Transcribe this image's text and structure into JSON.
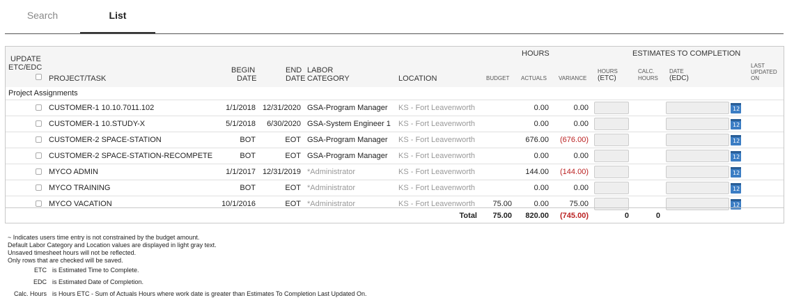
{
  "tabs": [
    {
      "label": "Search"
    },
    {
      "label": "List"
    }
  ],
  "headers": {
    "update": "UPDATE",
    "etc_edc": "ETC/EDC",
    "project_task": "PROJECT/TASK",
    "begin": "BEGIN",
    "begin2": "DATE",
    "end": "END",
    "end2": "DATE",
    "labor": "LABOR",
    "labor2": "CATEGORY",
    "location": "LOCATION",
    "hours": "HOURS",
    "budget": "BUDGET",
    "actuals": "ACTUALS",
    "variance": "VARIANCE",
    "etc_group": "ESTIMATES TO COMPLETION",
    "hours_etc_a": "HOURS",
    "hours_etc_b": "(ETC)",
    "calc_a": "CALC.",
    "calc_b": "HOURS",
    "date_edc_a": "DATE",
    "date_edc_b": "(EDC)",
    "last_a": "LAST",
    "last_b": "UPDATED",
    "last_c": "ON"
  },
  "section_label": "Project Assignments",
  "rows": [
    {
      "project": "CUSTOMER-1 10.10.7011.102",
      "begin": "1/1/2018",
      "end": "12/31/2020",
      "labor": "GSA-Program Manager",
      "location": "KS - Fort Leavenworth",
      "budget": "",
      "actuals": "0.00",
      "variance": "0.00"
    },
    {
      "project": "CUSTOMER-1 10.STUDY-X",
      "begin": "5/1/2018",
      "end": "6/30/2020",
      "labor": "GSA-System Engineer 1",
      "location": "KS - Fort Leavenworth",
      "budget": "",
      "actuals": "0.00",
      "variance": "0.00"
    },
    {
      "project": "CUSTOMER-2 SPACE-STATION",
      "begin": "BOT",
      "end": "EOT",
      "labor": "GSA-Program Manager",
      "location": "KS - Fort Leavenworth",
      "budget": "",
      "actuals": "676.00",
      "variance": "(676.00)"
    },
    {
      "project": "CUSTOMER-2 SPACE-STATION-RECOMPETE",
      "begin": "BOT",
      "end": "EOT",
      "labor": "GSA-Program Manager",
      "location": "KS - Fort Leavenworth",
      "budget": "",
      "actuals": "0.00",
      "variance": "0.00"
    },
    {
      "project": "MYCO ADMIN",
      "begin": "1/1/2017",
      "end": "12/31/2019",
      "labor": "*Administrator",
      "location": "KS - Fort Leavenworth",
      "budget": "",
      "actuals": "144.00",
      "variance": "(144.00)"
    },
    {
      "project": "MYCO TRAINING",
      "begin": "BOT",
      "end": "EOT",
      "labor": "*Administrator",
      "location": "KS - Fort Leavenworth",
      "budget": "",
      "actuals": "0.00",
      "variance": "0.00"
    },
    {
      "project": "MYCO VACATION",
      "begin": "10/1/2016",
      "end": "EOT",
      "labor": "*Administrator",
      "location": "KS - Fort Leavenworth",
      "budget": "75.00",
      "actuals": "0.00",
      "variance": "75.00"
    }
  ],
  "total": {
    "label": "Total",
    "budget": "75.00",
    "actuals": "820.00",
    "variance": "(745.00)",
    "hours_etc": "0",
    "calc_hours": "0"
  },
  "notes": [
    "~ Indicates users time entry is not constrained by the budget amount.",
    "Default Labor Category and Location values are displayed in light gray text.",
    "Unsaved timesheet hours will not be reflected.",
    "Only rows that are checked will be saved."
  ],
  "legend": [
    {
      "key": "ETC",
      "text": "is Estimated Time to Complete."
    },
    {
      "key": "EDC",
      "text": "is Estimated Date of Completion."
    },
    {
      "key": "Calc. Hours",
      "text": "is Hours ETC - Sum of Actuals Hours where work date is greater than Estimates To Completion Last Updated On."
    }
  ],
  "colors": {
    "negative": "#b22222",
    "default_gray": "#999999",
    "calendar": "#3b7dc4"
  }
}
